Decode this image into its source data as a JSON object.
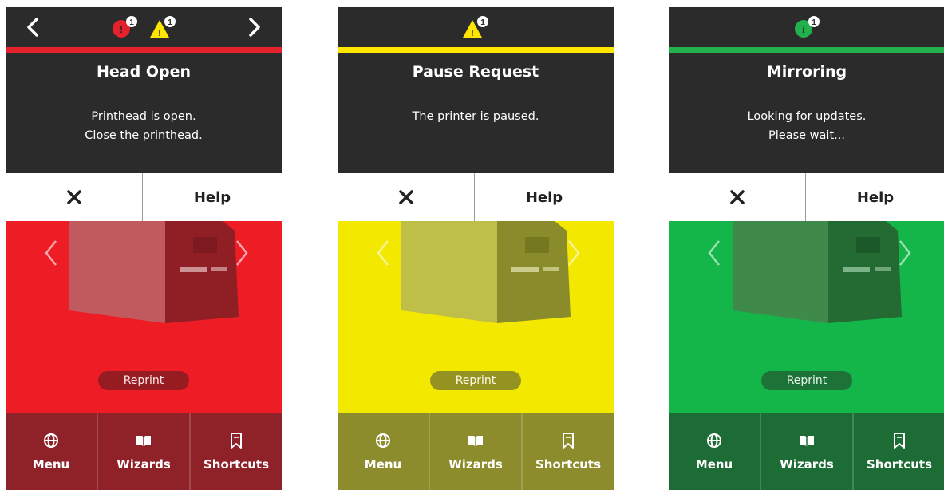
{
  "screens": [
    {
      "title": "Head Open",
      "message_line1": "Printhead is open.",
      "message_line2": "Close the printhead.",
      "close_symbol": "✕",
      "help_label": "Help",
      "reprint_label": "Reprint",
      "menu_label": "Menu",
      "wizards_label": "Wizards",
      "shortcuts_label": "Shortcuts",
      "status_icons": [
        "error-alert-icon",
        "warning-alert-icon"
      ],
      "colors": {
        "accent": "#e5212b",
        "hero": "#ee1d25",
        "bottom": "#8f2228",
        "pill": "#8e1c22"
      }
    },
    {
      "title": "Pause Request",
      "message_line1": "The printer is paused.",
      "message_line2": "",
      "close_symbol": "✕",
      "help_label": "Help",
      "reprint_label": "Reprint",
      "menu_label": "Menu",
      "wizards_label": "Wizards",
      "shortcuts_label": "Shortcuts",
      "status_icons": [
        "warning-alert-icon"
      ],
      "colors": {
        "accent": "#ffe600",
        "hero": "#f3e800",
        "bottom": "#8d8c2c",
        "pill": "#8a8a25"
      }
    },
    {
      "title": "Mirroring",
      "message_line1": "Looking for updates.",
      "message_line2": "Please wait...",
      "close_symbol": "✕",
      "help_label": "Help",
      "reprint_label": "Reprint",
      "menu_label": "Menu",
      "wizards_label": "Wizards",
      "shortcuts_label": "Shortcuts",
      "status_icons": [
        "info-alert-icon"
      ],
      "colors": {
        "accent": "#22b14c",
        "hero": "#14b64a",
        "bottom": "#1d6b35",
        "pill": "#1d6b35"
      }
    }
  ]
}
